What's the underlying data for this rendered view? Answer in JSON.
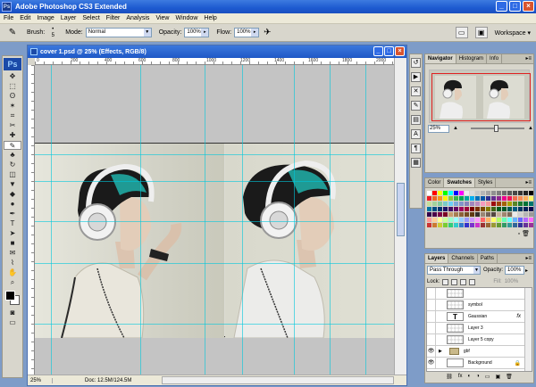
{
  "app": {
    "title": "Adobe Photoshop CS3 Extended",
    "window_buttons": [
      "_",
      "□",
      "×"
    ]
  },
  "menu": [
    "File",
    "Edit",
    "Image",
    "Layer",
    "Select",
    "Filter",
    "Analysis",
    "View",
    "Window",
    "Help"
  ],
  "options_bar": {
    "brush_label": "Brush:",
    "brush_size": "5",
    "mode_label": "Mode:",
    "mode_value": "Normal",
    "opacity_label": "Opacity:",
    "opacity_value": "100%",
    "flow_label": "Flow:",
    "flow_value": "100%",
    "workspace_label": "Workspace ▾"
  },
  "toolbox": {
    "logo": "Ps",
    "tools": [
      "move-icon",
      "marquee-icon",
      "lasso-icon",
      "magic-wand-icon",
      "crop-icon",
      "slice-icon",
      "healing-icon",
      "brush-icon",
      "stamp-icon",
      "history-brush-icon",
      "eraser-icon",
      "fill-icon",
      "blur-icon",
      "dodge-icon",
      "pen-icon",
      "type-icon",
      "path-select-icon",
      "shape-icon",
      "notes-icon",
      "eyedropper-icon",
      "hand-icon",
      "zoom-icon"
    ],
    "tool_glyphs": [
      "✥",
      "⬚",
      "ʘ",
      "✶",
      "⌗",
      "✂",
      "✚",
      "✎",
      "♣",
      "↻",
      "◫",
      "▼",
      "◆",
      "●",
      "✒",
      "T",
      "➤",
      "■",
      "✉",
      "⌇",
      "✋",
      "⌕"
    ]
  },
  "document": {
    "title": "cover 1.psd @ 25% (Effects, RGB/8)",
    "ruler_labels": [
      "0",
      "200",
      "400",
      "600",
      "800",
      "1000",
      "1200",
      "1400",
      "1600",
      "1800",
      "2000"
    ],
    "zoom": "25%",
    "doc_size": "Doc: 12.5M/124.5M"
  },
  "navigator": {
    "tabs": [
      "Navigator",
      "Histogram",
      "Info"
    ],
    "zoom": "25%"
  },
  "swatches": {
    "tabs": [
      "Color",
      "Swatches",
      "Styles"
    ],
    "colors": [
      "#ffffff",
      "#ff0000",
      "#ffff00",
      "#00ff00",
      "#00ffff",
      "#0000ff",
      "#ff00ff",
      "#ededed",
      "#dbdbdb",
      "#c8c8c8",
      "#b6b6b6",
      "#a3a3a3",
      "#919191",
      "#7e7e7e",
      "#6c6c6c",
      "#595959",
      "#474747",
      "#343434",
      "#222222",
      "#000000",
      "#ed1c24",
      "#f26522",
      "#f7941d",
      "#fff200",
      "#8dc63f",
      "#39b54a",
      "#00a651",
      "#00a99d",
      "#00aeef",
      "#0072bc",
      "#0054a6",
      "#2e3192",
      "#662d91",
      "#92278f",
      "#ec008c",
      "#ed145b",
      "#f26c4f",
      "#f68e56",
      "#fbaf5d",
      "#fff568",
      "#c4df9b",
      "#a3d39c",
      "#82ca9c",
      "#7accc8",
      "#6dcff6",
      "#7da7d9",
      "#8393ca",
      "#8781bd",
      "#a187be",
      "#bd8cbf",
      "#f49ac1",
      "#f5989d",
      "#9e0b0f",
      "#a0410d",
      "#a36209",
      "#aba000",
      "#598527",
      "#1a7b30",
      "#007236",
      "#00746b",
      "#0076a3",
      "#004b80",
      "#003471",
      "#1b1464",
      "#440e62",
      "#630460",
      "#9e005d",
      "#9e0039",
      "#790000",
      "#7b2e00",
      "#7d4900",
      "#827b00",
      "#406618",
      "#005e20",
      "#005826",
      "#005952",
      "#005b7f",
      "#003663",
      "#002157",
      "#0d004c",
      "#32004b",
      "#4b0049",
      "#7b0046",
      "#7a0026",
      "#c69c6d",
      "#a67c52",
      "#8c6239",
      "#754c24",
      "#603913",
      "#362f2d",
      "#998675",
      "#736357",
      "#534741",
      "#c7b299",
      "#a0856f",
      "#7d6a58",
      "#ebebeb",
      "#d0d0d0",
      "#b5b5b5",
      "#9a9a9a",
      "#ff9999",
      "#ffcc99",
      "#ffff99",
      "#ccff99",
      "#99ffcc",
      "#99ffff",
      "#99ccff",
      "#9999ff",
      "#cc99ff",
      "#ff99ff",
      "#ff6666",
      "#ffb366",
      "#ffff66",
      "#b3ff66",
      "#66ffb3",
      "#66ffff",
      "#66b3ff",
      "#6666ff",
      "#b366ff",
      "#ff66ff",
      "#cc3333",
      "#cc7a33",
      "#cccc33",
      "#7acc33",
      "#33cc7a",
      "#33cccc",
      "#337acc",
      "#3333cc",
      "#7a33cc",
      "#cc33cc",
      "#993333",
      "#996633",
      "#999933",
      "#669933",
      "#339966",
      "#339999",
      "#336699",
      "#333399",
      "#663399",
      "#993399"
    ]
  },
  "layers": {
    "tabs": [
      "Layers",
      "Channels",
      "Paths"
    ],
    "blend_mode": "Pass Through",
    "opacity_label": "Opacity:",
    "opacity_value": "100%",
    "lock_label": "Lock:",
    "fill_label": "Fill:",
    "fill_value": "100%",
    "items": [
      {
        "name": "",
        "thumb": "checker",
        "visible": false,
        "fx": "",
        "locked": false
      },
      {
        "name": "symbol",
        "thumb": "checker",
        "visible": false,
        "fx": "",
        "locked": false
      },
      {
        "name": "Gaussian",
        "thumb": "type",
        "visible": false,
        "fx": "fx",
        "locked": false
      },
      {
        "name": "Layer 3",
        "thumb": "checker",
        "visible": false,
        "fx": "",
        "locked": false
      },
      {
        "name": "Layer 5 copy",
        "thumb": "checker",
        "visible": false,
        "fx": "",
        "locked": false
      },
      {
        "name": "gbf",
        "thumb": "folder",
        "visible": true,
        "fx": "",
        "locked": false
      },
      {
        "name": "Background",
        "thumb": "white",
        "visible": true,
        "fx": "",
        "locked": true
      }
    ],
    "footer_icons": [
      "⛓",
      "fx",
      "◐",
      "◑",
      "▭",
      "▣",
      "🗑"
    ]
  }
}
